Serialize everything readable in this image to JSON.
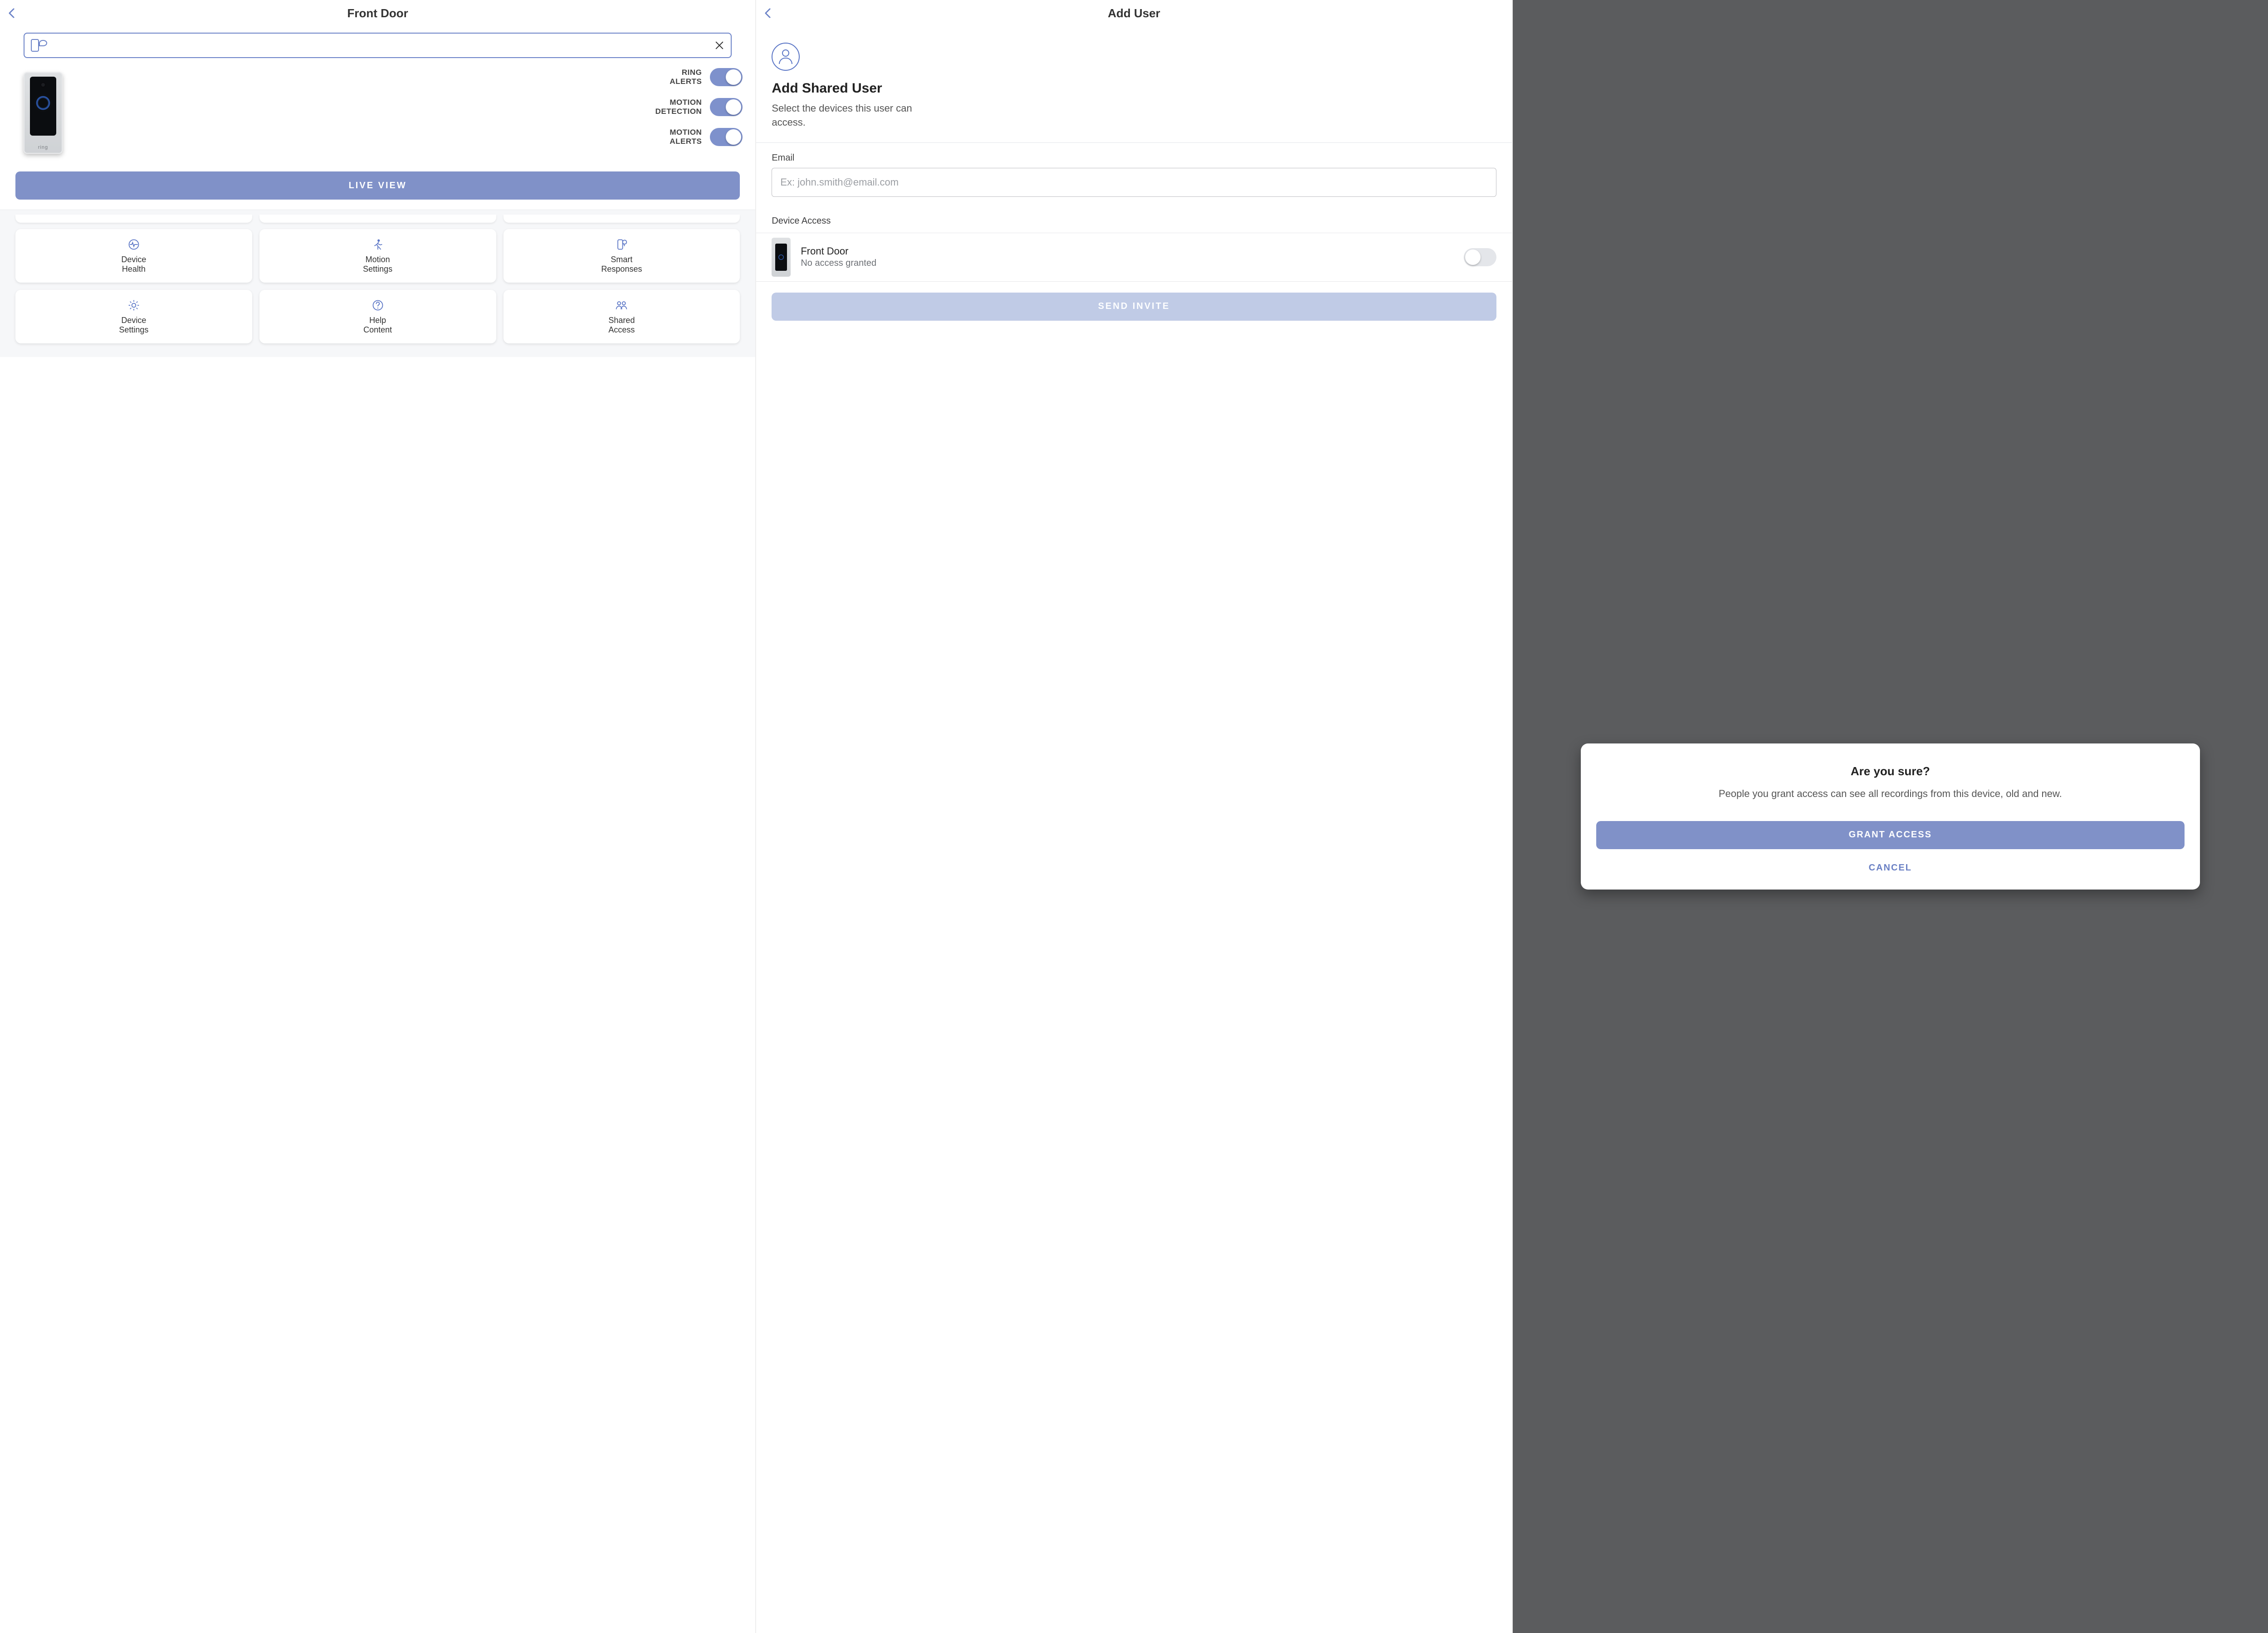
{
  "screen1": {
    "title": "Front Door",
    "device_brand": "ring",
    "toggles": {
      "ring_alerts": "RING\nALERTS",
      "motion_detection": "MOTION\nDETECTION",
      "motion_alerts": "MOTION\nALERTS"
    },
    "live_button": "LIVE VIEW",
    "tiles": [
      {
        "label": "Device\nHealth",
        "icon": "device-health-icon"
      },
      {
        "label": "Motion\nSettings",
        "icon": "motion-settings-icon"
      },
      {
        "label": "Smart\nResponses",
        "icon": "smart-responses-icon"
      },
      {
        "label": "Device\nSettings",
        "icon": "device-settings-icon"
      },
      {
        "label": "Help\nContent",
        "icon": "help-content-icon"
      },
      {
        "label": "Shared\nAccess",
        "icon": "shared-access-icon"
      }
    ]
  },
  "screen2": {
    "title": "Add User",
    "heading": "Add Shared User",
    "subtext": "Select the devices this user can access.",
    "email_label": "Email",
    "email_placeholder": "Ex: john.smith@email.com",
    "device_access_label": "Device Access",
    "device_name": "Front Door",
    "device_status": "No access granted",
    "send_button": "SEND INVITE"
  },
  "screen3": {
    "title": "Are you sure?",
    "body": "People you grant access can see all recordings from this device, old and new.",
    "primary": "GRANT ACCESS",
    "secondary": "CANCEL"
  }
}
